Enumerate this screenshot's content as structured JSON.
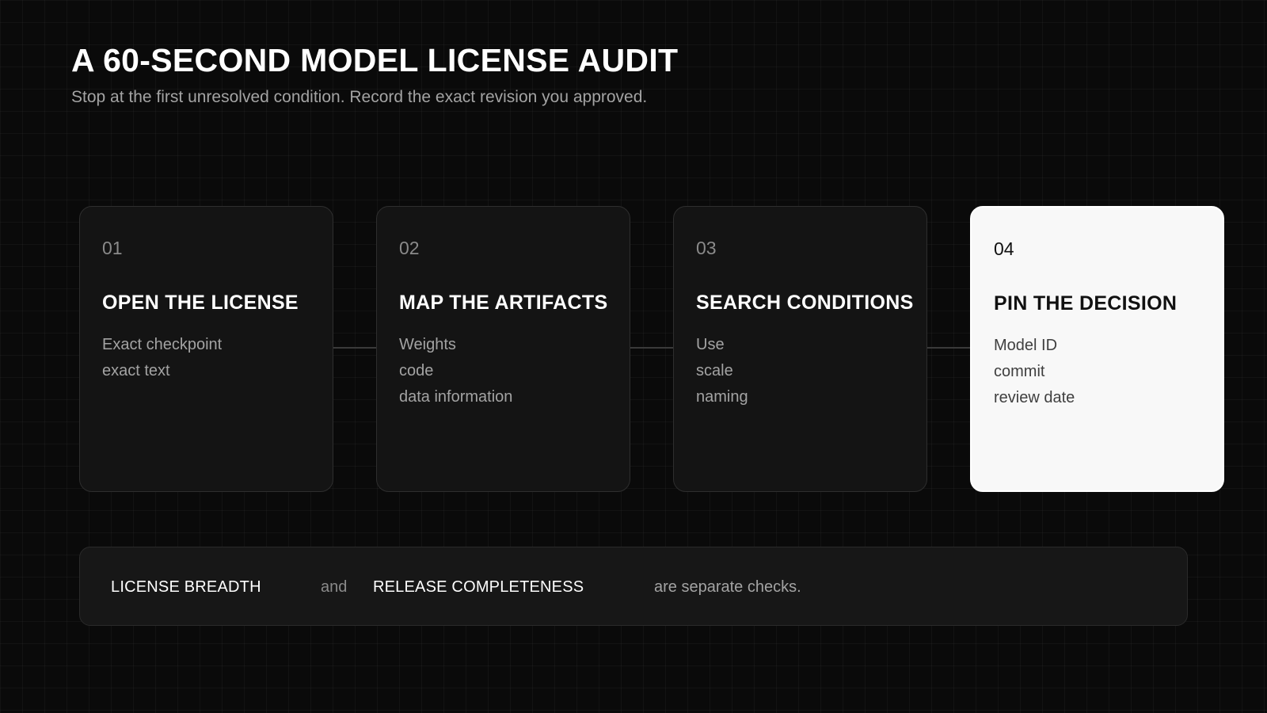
{
  "header": {
    "title": "A 60-SECOND MODEL LICENSE AUDIT",
    "subtitle": "Stop at the first unresolved condition. Record the exact revision you approved."
  },
  "steps": [
    {
      "number": "01",
      "title": "OPEN THE LICENSE",
      "items": [
        "Exact checkpoint",
        "exact text"
      ]
    },
    {
      "number": "02",
      "title": "MAP THE ARTIFACTS",
      "items": [
        "Weights",
        "code",
        "data information"
      ]
    },
    {
      "number": "03",
      "title": "SEARCH CONDITIONS",
      "items": [
        "Use",
        "scale",
        "naming"
      ]
    },
    {
      "number": "04",
      "title": "PIN THE DECISION",
      "items": [
        "Model ID",
        "commit",
        "review date"
      ],
      "highlighted": true
    }
  ],
  "note": {
    "term1": "LICENSE BREADTH",
    "joiner": "and",
    "term2": "RELEASE COMPLETENESS",
    "rest": "are separate checks."
  }
}
